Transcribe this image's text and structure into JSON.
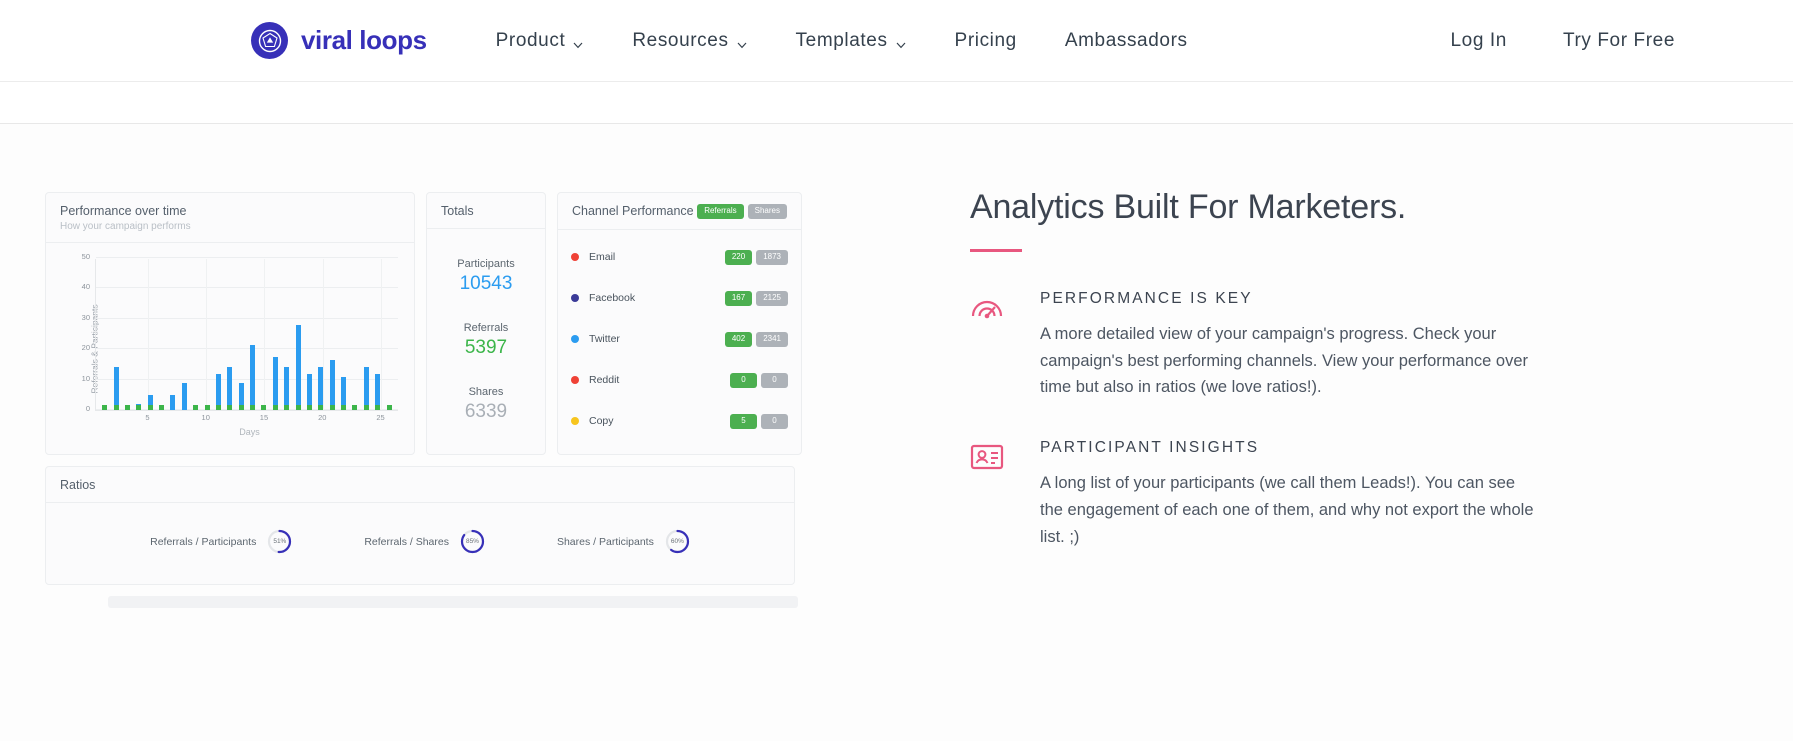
{
  "nav": {
    "brand": "viral loops",
    "brand_icon": "viral-loops-logo-icon",
    "brand_color": "#3730b8",
    "links": [
      {
        "label": "Product",
        "has_chevron": true
      },
      {
        "label": "Resources",
        "has_chevron": true
      },
      {
        "label": "Templates",
        "has_chevron": true
      },
      {
        "label": "Pricing",
        "has_chevron": false
      },
      {
        "label": "Ambassadors",
        "has_chevron": false
      }
    ],
    "right_links": [
      {
        "label": "Log In"
      },
      {
        "label": "Try For Free"
      }
    ]
  },
  "dashboard": {
    "performance": {
      "title": "Performance over time",
      "subtitle": "How your campaign performs"
    },
    "totals": {
      "title": "Totals",
      "items": [
        {
          "label": "Participants",
          "value": "10543",
          "color": "#2b9cf0"
        },
        {
          "label": "Referrals",
          "value": "5397",
          "color": "#3cb54a"
        },
        {
          "label": "Shares",
          "value": "6339",
          "color": "#a9afb6"
        }
      ]
    },
    "channels": {
      "title": "Channel Performance",
      "header_badges": [
        {
          "label": "Referrals",
          "type": "green"
        },
        {
          "label": "Shares",
          "type": "grey"
        }
      ],
      "rows": [
        {
          "name": "Email",
          "dot_color": "#ef4136",
          "referrals": "220",
          "shares": "1873"
        },
        {
          "name": "Facebook",
          "dot_color": "#3b3b98",
          "referrals": "167",
          "shares": "2125"
        },
        {
          "name": "Twitter",
          "dot_color": "#2b9cf0",
          "referrals": "402",
          "shares": "2341"
        },
        {
          "name": "Reddit",
          "dot_color": "#ef4136",
          "referrals": "0",
          "shares": "0"
        },
        {
          "name": "Copy",
          "dot_color": "#f7c51e",
          "referrals": "5",
          "shares": "0"
        }
      ]
    },
    "ratios": {
      "title": "Ratios",
      "items": [
        {
          "label": "Referrals / Participants",
          "pct": "51%",
          "value": 51
        },
        {
          "label": "Referrals / Shares",
          "pct": "85%",
          "value": 85
        },
        {
          "label": "Shares / Participants",
          "pct": "60%",
          "value": 60
        }
      ]
    }
  },
  "chart_data": {
    "type": "bar",
    "title": "Performance over time",
    "subtitle": "How your campaign performs",
    "xlabel": "Days",
    "ylabel": "Referrals & Participants",
    "ylim": [
      0,
      50
    ],
    "yticks": [
      0,
      10,
      20,
      30,
      40,
      50
    ],
    "xticks": [
      5,
      10,
      15,
      20,
      25
    ],
    "grid": true,
    "legend": "none",
    "x": [
      1,
      2,
      3,
      4,
      5,
      6,
      7,
      8,
      9,
      10,
      11,
      12,
      13,
      14,
      15,
      16,
      17,
      18,
      19,
      20,
      21,
      22,
      23,
      24,
      25,
      26
    ],
    "series": [
      {
        "name": "Participants",
        "color": "#2b9cf0",
        "values": [
          1.5,
          14,
          1,
          2,
          5,
          1.5,
          5,
          9,
          1,
          1,
          12,
          14,
          9,
          21.5,
          1.5,
          17.5,
          14,
          28,
          12,
          14,
          16.5,
          11,
          1.5,
          14,
          12,
          1
        ]
      },
      {
        "name": "Referrals",
        "color": "#3cb54a",
        "values": [
          1.5,
          1.5,
          1.5,
          1.5,
          1.5,
          1.5,
          0,
          0,
          1.5,
          1.5,
          1.5,
          1.5,
          1.5,
          1.5,
          1.5,
          1.5,
          1.5,
          1.5,
          1.5,
          1.5,
          1.5,
          1.5,
          1.5,
          1.5,
          1.5,
          1.5
        ]
      }
    ]
  },
  "content": {
    "headline": "Analytics Built For Marketers.",
    "accent_color": "#e8577f",
    "features": [
      {
        "icon": "gauge-icon",
        "title": "PERFORMANCE IS KEY",
        "body": "A more detailed view of your campaign's progress. Check your campaign's best performing channels. View your performance over time but also in ratios (we love ratios!)."
      },
      {
        "icon": "contact-card-icon",
        "title": "PARTICIPANT INSIGHTS",
        "body": "A long list of your participants (we call them Leads!). You can see the engagement of each one of them, and why not export the whole list. ;)"
      }
    ]
  }
}
